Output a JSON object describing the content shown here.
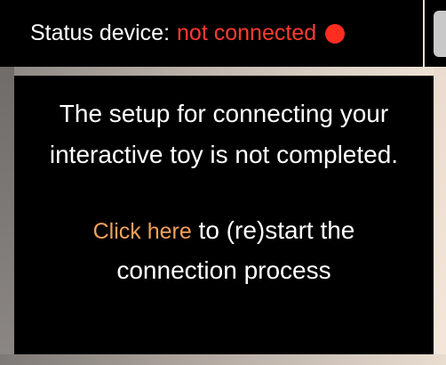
{
  "status": {
    "label": "Status device:",
    "value": "not connected",
    "indicator_color": "#ff2d20",
    "value_color": "#ff3b30"
  },
  "panel": {
    "message": "The setup for connecting your interactive toy is not completed.",
    "action_link": "Click here",
    "action_text": " to (re)start the connection process",
    "link_color": "#f0a15c"
  }
}
